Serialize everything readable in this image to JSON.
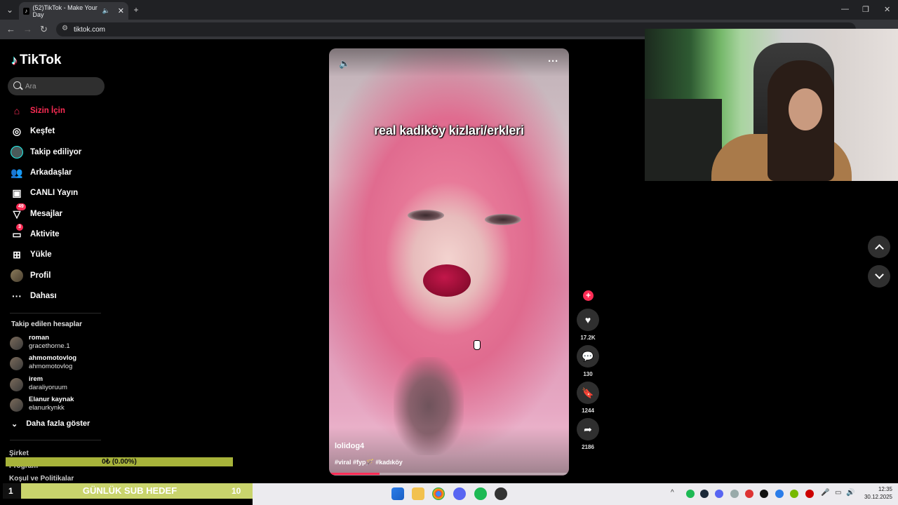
{
  "browser": {
    "tab_title": "(52)TikTok - Make Your Day",
    "url": "tiktok.com"
  },
  "brand": "TikTok",
  "search": {
    "placeholder": "Ara"
  },
  "nav": [
    {
      "label": "Sizin İçin",
      "icon": "home-icon",
      "active": true
    },
    {
      "label": "Keşfet",
      "icon": "compass-icon"
    },
    {
      "label": "Takip ediliyor",
      "icon": "following-avatar-icon"
    },
    {
      "label": "Arkadaşlar",
      "icon": "friends-icon"
    },
    {
      "label": "CANLI Yayın",
      "icon": "live-icon"
    },
    {
      "label": "Mesajlar",
      "icon": "messages-icon",
      "badge": "49"
    },
    {
      "label": "Aktivite",
      "icon": "activity-icon",
      "badge": "3"
    },
    {
      "label": "Yükle",
      "icon": "upload-icon"
    },
    {
      "label": "Profil",
      "icon": "profile-avatar-icon"
    },
    {
      "label": "Dahası",
      "icon": "more-icon"
    }
  ],
  "following": {
    "title": "Takip edilen hesaplar",
    "accounts": [
      {
        "name": "roman",
        "handle": "gracethorne.1"
      },
      {
        "name": "ahmomotovlog",
        "handle": "ahmomotovlog"
      },
      {
        "name": "irem",
        "handle": "daraliyoruum"
      },
      {
        "name": "Elanur kaynak",
        "handle": "elanurkynkk"
      }
    ],
    "show_more": "Daha fazla göster"
  },
  "footer": [
    "Şirket",
    "Program",
    "Koşul ve Politikalar"
  ],
  "overlay": {
    "sub_progress_text": "0₺ (0.00%)",
    "sub_progress": 0,
    "goal_number": "1",
    "goal_label": "GÜNLÜK SUB HEDEF",
    "goal_count": "10"
  },
  "video": {
    "caption": "real kadiköy kizlari/erkleri",
    "author": "lolidog4",
    "tags": "#viral #fyp🪄 #kadıköy",
    "progress": 0.21
  },
  "actions": {
    "likes": "17.2K",
    "comments": "130",
    "saves": "1244",
    "shares": "2186"
  },
  "clock": {
    "time": "12:35",
    "date": "30.12.2025"
  },
  "colors": {
    "accent": "#fe2c55",
    "goal_bar": "#c9d46c",
    "progress_bar": "#a7b33a"
  }
}
